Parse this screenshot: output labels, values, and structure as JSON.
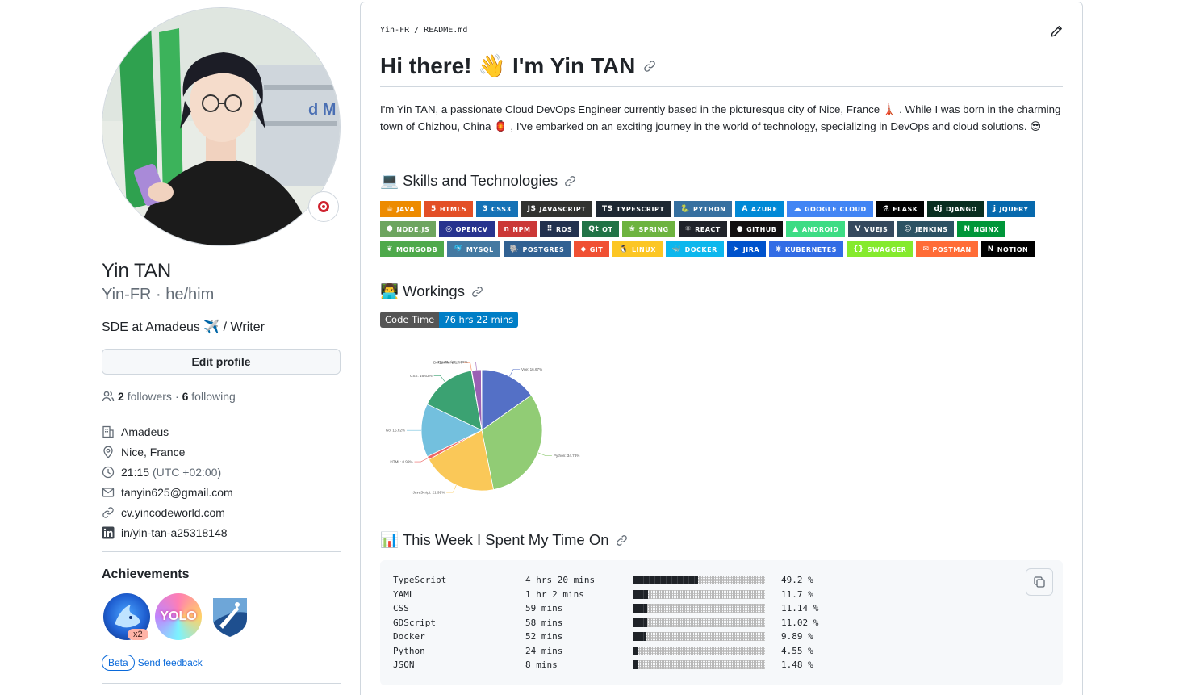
{
  "profile": {
    "full_name": "Yin TAN",
    "username": "Yin-FR",
    "pronouns": "he/him",
    "username_line": "Yin-FR · he/him",
    "bio": "SDE at Amadeus ✈️ / Writer",
    "edit_label": "Edit profile",
    "followers_count": "2",
    "followers_label": "followers",
    "following_count": "6",
    "following_label": "following",
    "company": "Amadeus",
    "location": "Nice, France",
    "local_time": "21:15",
    "timezone": "(UTC +02:00)",
    "email": "tanyin625@gmail.com",
    "website": "cv.yincodeworld.com",
    "linkedin": "in/yin-tan-a25318148"
  },
  "achievements": {
    "title": "Achievements",
    "items": [
      {
        "icon": "pull-shark-badge",
        "count": "x2"
      },
      {
        "icon": "yolo-badge",
        "label": "YOLO"
      },
      {
        "icon": "arctic-code-vault-badge"
      }
    ],
    "beta_label": "Beta",
    "feedback_label": "Send feedback"
  },
  "readme": {
    "breadcrumb": "Yin-FR / README.md",
    "title": "Hi there! 👋 I'm Yin TAN",
    "intro": "I'm Yin TAN, a passionate Cloud DevOps Engineer currently based in the picturesque city of Nice, France 🗼 . While I was born in the charming town of Chizhou, China 🏮 , I've embarked on an exciting journey in the world of technology, specializing in DevOps and cloud solutions. 😎",
    "skills_heading": "💻 Skills and Technologies",
    "workings_heading": "👨‍💻 Workings",
    "week_heading": "📊 This Week I Spent My Time On",
    "code_time_label": "Code Time",
    "code_time_value": "76 hrs 22 mins"
  },
  "shields": [
    [
      {
        "label": "JAVA",
        "color": "#ED8B00",
        "glyph": "☕"
      },
      {
        "label": "HTML5",
        "color": "#E34F26",
        "glyph": "5"
      },
      {
        "label": "CSS3",
        "color": "#1572B6",
        "glyph": "3"
      },
      {
        "label": "JAVASCRIPT",
        "color": "#323330",
        "glyph": "JS"
      },
      {
        "label": "TYPESCRIPT",
        "color": "#1e2833",
        "glyph": "TS"
      },
      {
        "label": "PYTHON",
        "color": "#3670A0",
        "glyph": "🐍"
      },
      {
        "label": "AZURE",
        "color": "#0089D6",
        "glyph": "A"
      },
      {
        "label": "GOOGLE CLOUD",
        "color": "#4285F4",
        "glyph": "☁"
      },
      {
        "label": "FLASK",
        "color": "#000000",
        "glyph": "⚗"
      },
      {
        "label": "DJANGO",
        "color": "#092E20",
        "glyph": "dj"
      },
      {
        "label": "JQUERY",
        "color": "#0769AD",
        "glyph": "ʝ"
      }
    ],
    [
      {
        "label": "NODE.JS",
        "color": "#6DA55F",
        "glyph": "⬢"
      },
      {
        "label": "OPENCV",
        "color": "#27338e",
        "glyph": "◎"
      },
      {
        "label": "NPM",
        "color": "#CB3837",
        "glyph": "n"
      },
      {
        "label": "ROS",
        "color": "#22314E",
        "glyph": "⠿"
      },
      {
        "label": "QT",
        "color": "#217346",
        "glyph": "Qt"
      },
      {
        "label": "SPRING",
        "color": "#6DB33F",
        "glyph": "❀"
      },
      {
        "label": "REACT",
        "color": "#20232a",
        "glyph": "⚛"
      },
      {
        "label": "GITHUB",
        "color": "#121011",
        "glyph": "●"
      },
      {
        "label": "ANDROID",
        "color": "#3DDC84",
        "glyph": "▲"
      },
      {
        "label": "VUEJS",
        "color": "#35495e",
        "glyph": "V"
      },
      {
        "label": "JENKINS",
        "color": "#2C5263",
        "glyph": "☺"
      },
      {
        "label": "NGINX",
        "color": "#009639",
        "glyph": "N"
      }
    ],
    [
      {
        "label": "MONGODB",
        "color": "#4ea94b",
        "glyph": "❦"
      },
      {
        "label": "MYSQL",
        "color": "#4479A1",
        "glyph": "🐬"
      },
      {
        "label": "POSTGRES",
        "color": "#316192",
        "glyph": "🐘"
      },
      {
        "label": "GIT",
        "color": "#F05033",
        "glyph": "◆"
      },
      {
        "label": "LINUX",
        "color": "#FCC624",
        "glyph": "🐧"
      },
      {
        "label": "DOCKER",
        "color": "#0db7ed",
        "glyph": "🐳"
      },
      {
        "label": "JIRA",
        "color": "#0052CC",
        "glyph": "➤"
      },
      {
        "label": "KUBERNETES",
        "color": "#326ce5",
        "glyph": "⎈"
      },
      {
        "label": "SWAGGER",
        "color": "#85EA2D",
        "glyph": "{}"
      },
      {
        "label": "POSTMAN",
        "color": "#FF6C37",
        "glyph": "✉"
      },
      {
        "label": "NOTION",
        "color": "#000000",
        "glyph": "N"
      }
    ]
  ],
  "chart_data": {
    "type": "pie",
    "title": "",
    "slices": [
      {
        "label": "Vue",
        "value": 16.67,
        "text": "Vue: 16.67%",
        "color": "#5470c6"
      },
      {
        "label": "Python",
        "value": 34.78,
        "text": "Python: 34.78%",
        "color": "#91cc75"
      },
      {
        "label": "JavaScript",
        "value": 21.99,
        "text": "JavaScript: 21.99%",
        "color": "#fac858"
      },
      {
        "label": "HTML",
        "value": 0.99,
        "text": "HTML: 0.99%",
        "color": "#ee6666"
      },
      {
        "label": "Go",
        "value": 15.62,
        "text": "Go: 15.62%",
        "color": "#73c0de"
      },
      {
        "label": "CSS",
        "value": 16.63,
        "text": "CSS: 16.63%",
        "color": "#3ba272"
      },
      {
        "label": "Dockerfile",
        "value": 0.11,
        "text": "Dockerfile: 0.11%",
        "color": "#fc8452"
      },
      {
        "label": "TypeScript",
        "value": 2.76,
        "text": "TypeScript: 2.76%",
        "color": "#9a60b4"
      },
      {
        "label": "Other",
        "value": 0.15,
        "text": "",
        "color": "#ea7ccc"
      }
    ]
  },
  "week": {
    "rows": [
      {
        "name": "TypeScript",
        "time": "4 hrs 20 mins",
        "percent": "49.2 %",
        "fraction": 0.492
      },
      {
        "name": "YAML",
        "time": "1 hr 2 mins",
        "percent": "11.7 %",
        "fraction": 0.117
      },
      {
        "name": "CSS",
        "time": "59 mins",
        "percent": "11.14 %",
        "fraction": 0.1114
      },
      {
        "name": "GDScript",
        "time": "58 mins",
        "percent": "11.02 %",
        "fraction": 0.1102
      },
      {
        "name": "Docker",
        "time": "52 mins",
        "percent": "9.89 %",
        "fraction": 0.0989
      },
      {
        "name": "Python",
        "time": "24 mins",
        "percent": "4.55 %",
        "fraction": 0.0455
      },
      {
        "name": "JSON",
        "time": "8 mins",
        "percent": "1.48 %",
        "fraction": 0.0148
      }
    ]
  }
}
